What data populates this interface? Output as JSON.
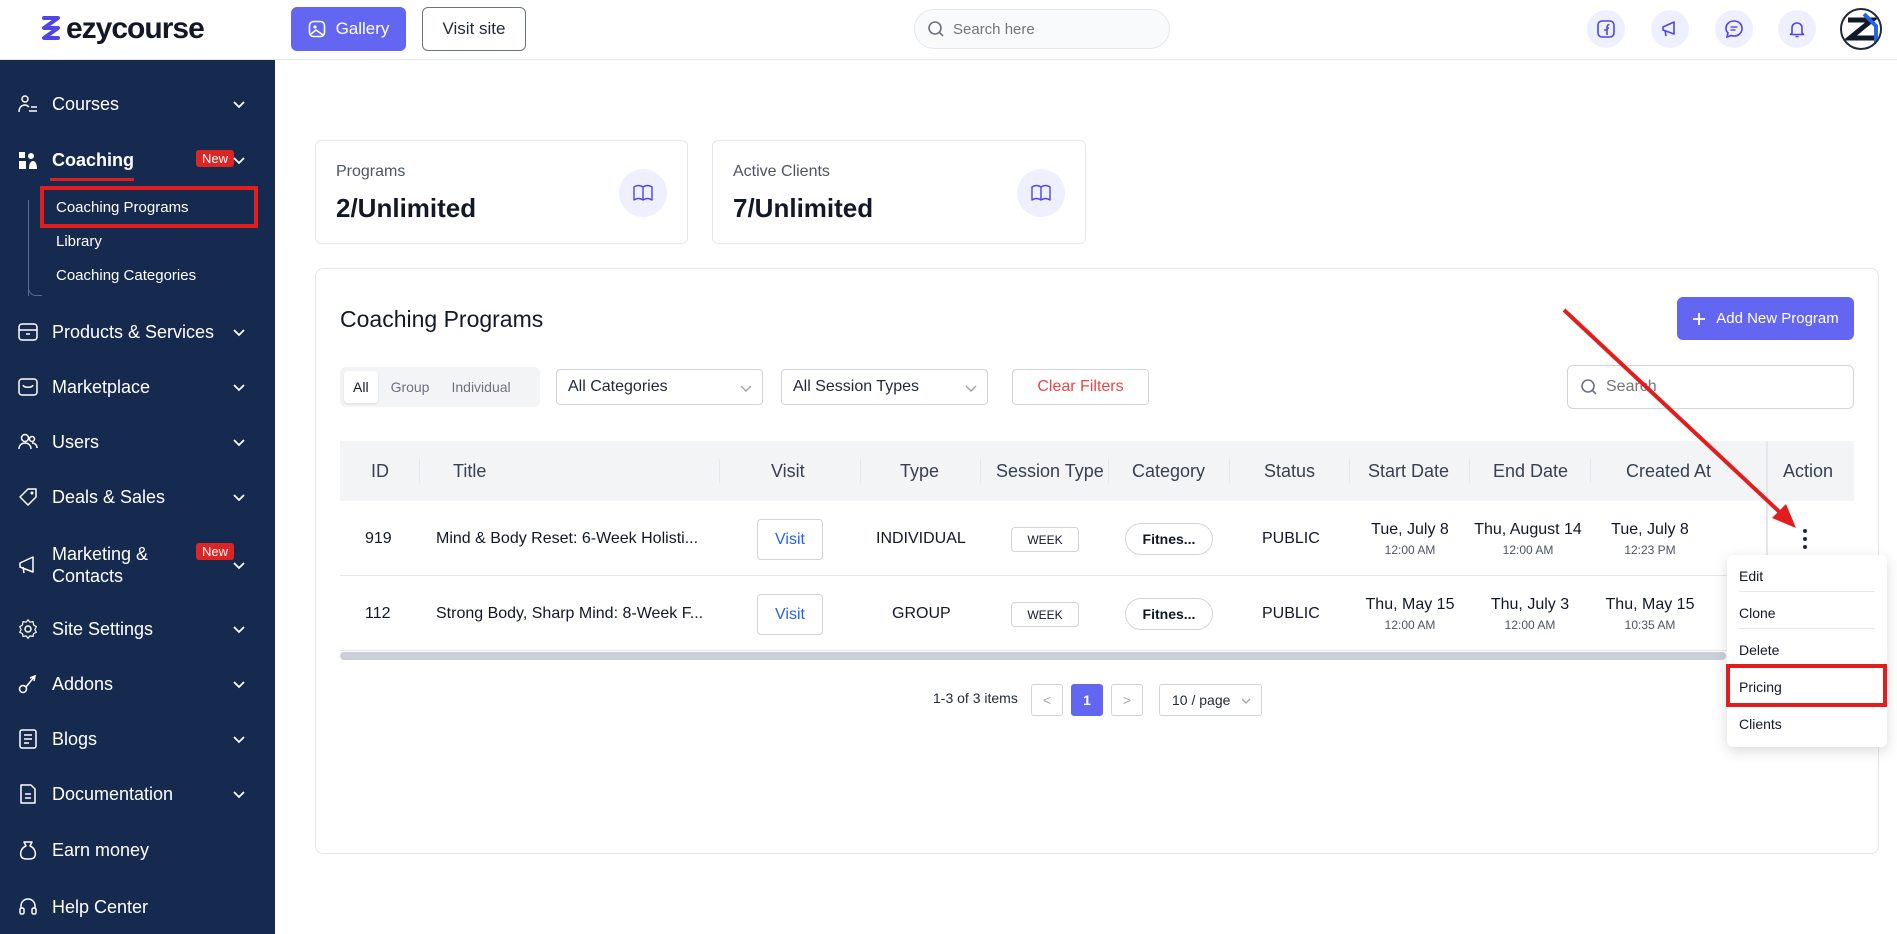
{
  "brand": {
    "name": "ezycourse"
  },
  "topbar": {
    "gallery_label": "Gallery",
    "visit_site_label": "Visit site",
    "search_placeholder": "Search here"
  },
  "sidebar": {
    "items": [
      {
        "label": "Courses",
        "icon": "courses-icon"
      },
      {
        "label": "Coaching",
        "icon": "coaching-icon",
        "badge": "New"
      },
      {
        "label": "Products & Services",
        "icon": "box-icon"
      },
      {
        "label": "Marketplace",
        "icon": "store-icon"
      },
      {
        "label": "Users",
        "icon": "users-icon"
      },
      {
        "label": "Deals & Sales",
        "icon": "tag-icon"
      },
      {
        "label": "Marketing &",
        "label2": "Contacts",
        "icon": "megaphone-icon",
        "badge": "New"
      },
      {
        "label": "Site Settings",
        "icon": "gear-icon"
      },
      {
        "label": "Addons",
        "icon": "addons-icon"
      },
      {
        "label": "Blogs",
        "icon": "blog-icon"
      },
      {
        "label": "Documentation",
        "icon": "document-icon"
      },
      {
        "label": "Earn money",
        "icon": "money-icon"
      },
      {
        "label": "Help Center",
        "icon": "help-icon"
      }
    ],
    "coaching_sub": [
      "Coaching Programs",
      "Library",
      "Coaching Categories"
    ]
  },
  "stats": [
    {
      "label": "Programs",
      "value": "2/Unlimited"
    },
    {
      "label": "Active Clients",
      "value": "7/Unlimited"
    }
  ],
  "panel": {
    "title": "Coaching Programs",
    "add_button": "Add New Program",
    "filters": {
      "segments": [
        "All",
        "Group",
        "Individual"
      ],
      "active_segment": "All",
      "categories": "All Categories",
      "session_types": "All Session Types",
      "clear": "Clear Filters",
      "search_placeholder": "Search"
    },
    "columns": [
      "ID",
      "Title",
      "Visit",
      "Type",
      "Session Type",
      "Category",
      "Status",
      "Start Date",
      "End Date",
      "Created At",
      "Action"
    ],
    "rows": [
      {
        "id": "919",
        "title": "Mind & Body Reset: 6-Week Holisti...",
        "visit": "Visit",
        "type": "INDIVIDUAL",
        "session_type": "WEEK",
        "category": "Fitnes...",
        "status": "PUBLIC",
        "start_date": "Tue, July 8",
        "start_time": "12:00 AM",
        "end_date": "Thu, August 14",
        "end_time": "12:00 AM",
        "created_date": "Tue, July 8",
        "created_time": "12:23 PM"
      },
      {
        "id": "112",
        "title": "Strong Body, Sharp Mind: 8-Week F...",
        "visit": "Visit",
        "type": "GROUP",
        "session_type": "WEEK",
        "category": "Fitnes...",
        "status": "PUBLIC",
        "start_date": "Thu, May 15",
        "start_time": "12:00 AM",
        "end_date": "Thu, July 3",
        "end_time": "12:00 AM",
        "created_date": "Thu, May 15",
        "created_time": "10:35 AM"
      }
    ],
    "pagination": {
      "summary": "1-3 of 3 items",
      "prev": "<",
      "page": "1",
      "next": ">",
      "page_size": "10 / page"
    }
  },
  "action_menu": [
    "Edit",
    "Clone",
    "Delete",
    "Pricing",
    "Clients"
  ],
  "colors": {
    "sidebar": "#16294e",
    "primary": "#6366f1",
    "highlight": "#e11d1d",
    "danger": "#ef4444"
  }
}
